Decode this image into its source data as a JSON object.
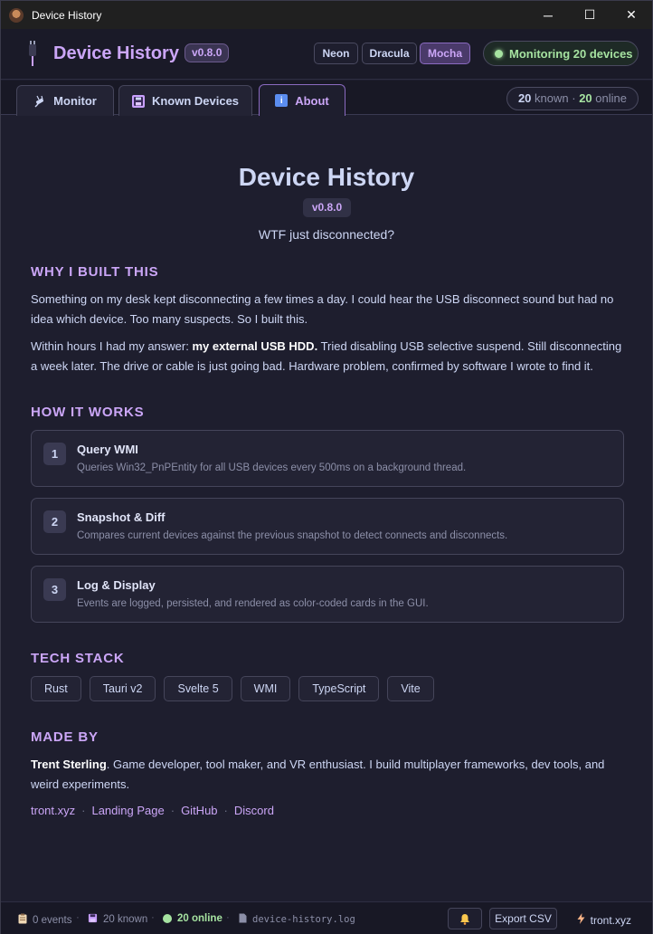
{
  "window": {
    "title": "Device History",
    "minimize": "─",
    "maximize": "☐",
    "close": "✕"
  },
  "header": {
    "brand": "Device History",
    "version": "v0.8.0",
    "themes": [
      "Neon",
      "Dracula",
      "Mocha"
    ],
    "active_theme": "Mocha",
    "monitoring": "Monitoring 20 devices"
  },
  "tabs": [
    {
      "label": "Monitor",
      "icon": "plug-icon"
    },
    {
      "label": "Known Devices",
      "icon": "floppy-icon"
    },
    {
      "label": "About",
      "icon": "info-icon",
      "active": true
    }
  ],
  "counts": {
    "known": "20",
    "known_label": "known",
    "sep": "·",
    "online": "20",
    "online_label": "online"
  },
  "about": {
    "title": "Device History",
    "version": "v0.8.0",
    "tagline": "WTF just disconnected?",
    "why_title": "WHY I BUILT THIS",
    "why_p1": "Something on my desk kept disconnecting a few times a day. I could hear the USB disconnect sound but had no idea which device. Too many suspects. So I built this.",
    "why_p2_pre": "Within hours I had my answer: ",
    "why_p2_bold": "my external USB HDD.",
    "why_p2_post": " Tried disabling USB selective suspend. Still disconnecting a week later. The drive or cable is just going bad. Hardware problem, confirmed by software I wrote to find it.",
    "how_title": "HOW IT WORKS",
    "steps": [
      {
        "num": "1",
        "title": "Query WMI",
        "desc": "Queries Win32_PnPEntity for all USB devices every 500ms on a background thread."
      },
      {
        "num": "2",
        "title": "Snapshot & Diff",
        "desc": "Compares current devices against the previous snapshot to detect connects and disconnects."
      },
      {
        "num": "3",
        "title": "Log & Display",
        "desc": "Events are logged, persisted, and rendered as color-coded cards in the GUI."
      }
    ],
    "stack_title": "TECH STACK",
    "stack": [
      "Rust",
      "Tauri v2",
      "Svelte 5",
      "WMI",
      "TypeScript",
      "Vite"
    ],
    "made_title": "MADE BY",
    "made_name": "Trent Sterling",
    "made_desc": ". Game developer, tool maker, and VR enthusiast. I build multiplayer frameworks, dev tools, and weird experiments.",
    "links": [
      "tront.xyz",
      "Landing Page",
      "GitHub",
      "Discord"
    ],
    "link_sep": "·"
  },
  "statusbar": {
    "events": "0 events",
    "known": "20 known",
    "online": "20 online",
    "logfile": "device-history.log",
    "sep": "·",
    "export": "Export CSV",
    "tront": "tront.xyz"
  },
  "colors": {
    "accent": "#cba6f7",
    "online": "#a6e3a1",
    "background": "#1e1e2e"
  }
}
